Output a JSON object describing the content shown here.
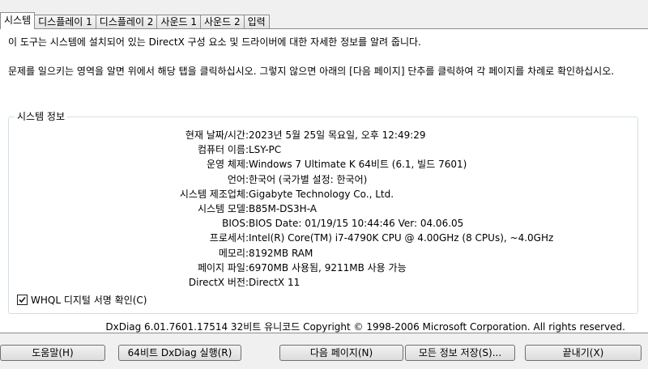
{
  "tabs": [
    {
      "label": "시스템",
      "active": true
    },
    {
      "label": "디스플레이 1"
    },
    {
      "label": "디스플레이 2"
    },
    {
      "label": "사운드 1"
    },
    {
      "label": "사운드 2"
    },
    {
      "label": "입력"
    }
  ],
  "intro": {
    "line1": "이 도구는 시스템에 설치되어 있는 DirectX 구성 요소 및 드라이버에 대한 자세한 정보를 알려 줍니다.",
    "line2": "문제를 일으키는 영역을 알면 위에서 해당 탭을 클릭하십시오. 그렇지 않으면 아래의 [다음 페이지] 단추를 클릭하여 각 페이지를 차례로 확인하십시오."
  },
  "system_info": {
    "title": "시스템 정보",
    "rows": [
      {
        "label": "현재 날짜/시간:",
        "value": "2023년 5월 25일 목요일, 오후 12:49:29"
      },
      {
        "label": "컴퓨터 이름:",
        "value": "LSY-PC"
      },
      {
        "label": "운영 체제:",
        "value": "Windows 7 Ultimate K 64비트 (6.1, 빌드 7601)"
      },
      {
        "label": "언어:",
        "value": "한국어 (국가별 설정: 한국어)"
      },
      {
        "label": "시스템 제조업체:",
        "value": "Gigabyte Technology Co., Ltd."
      },
      {
        "label": "시스템 모델:",
        "value": "B85M-DS3H-A"
      },
      {
        "label": "BIOS:",
        "value": "BIOS Date: 01/19/15 10:44:46 Ver: 04.06.05"
      },
      {
        "label": "프로세서:",
        "value": "Intel(R) Core(TM) i7-4790K CPU @ 4.00GHz (8 CPUs), ~4.0GHz"
      },
      {
        "label": "메모리:",
        "value": "8192MB RAM"
      },
      {
        "label": "페이지 파일:",
        "value": "6970MB 사용됨, 9211MB 사용 가능"
      },
      {
        "label": "DirectX 버전:",
        "value": "DirectX 11"
      }
    ]
  },
  "whql": {
    "label": "WHQL 디지털 서명 확인(C)",
    "checked": true
  },
  "footer": "DxDiag 6.01.7601.17514 32비트 유니코드  Copyright © 1998-2006 Microsoft Corporation.  All rights reserved.",
  "buttons": {
    "help": "도움말(H)",
    "run64": "64비트 DxDiag 실행(R)",
    "next": "다음 페이지(N)",
    "save": "모든 정보 저장(S)...",
    "exit": "끝내기(X)"
  }
}
